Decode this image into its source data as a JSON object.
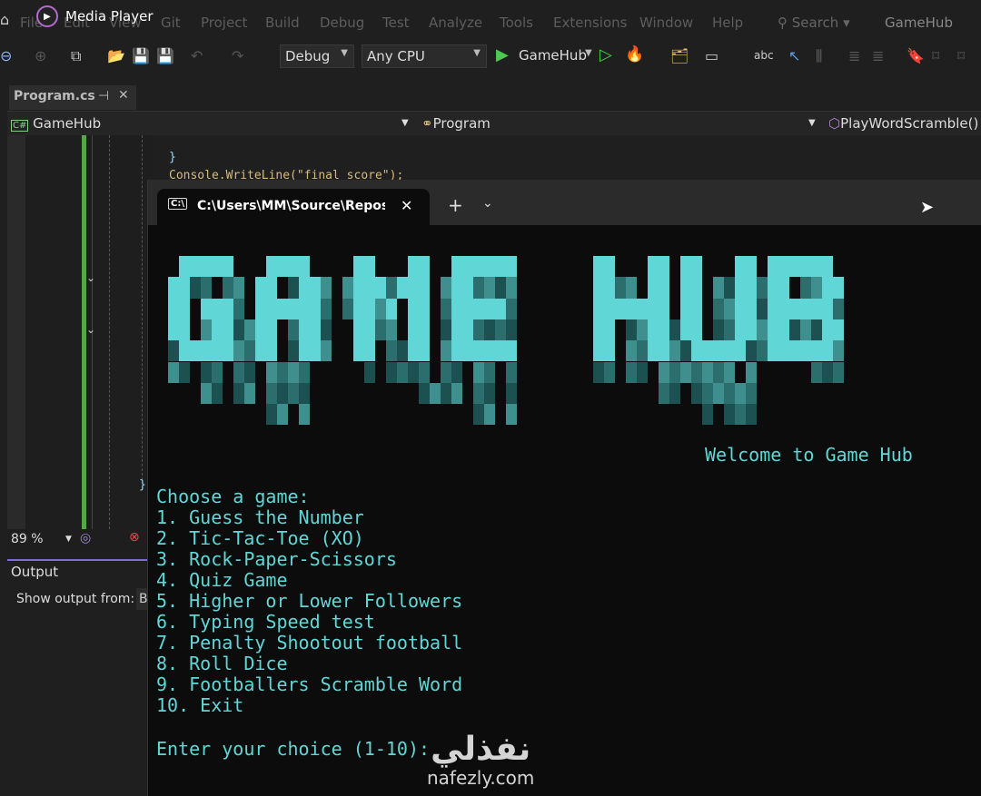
{
  "overlay": {
    "app": "Media Player"
  },
  "menu": [
    "File",
    "Edit",
    "View",
    "Git",
    "Project",
    "Build",
    "Debug",
    "Test",
    "Analyze",
    "Tools",
    "Extensions",
    "Window",
    "Help"
  ],
  "search": "Search",
  "solution_name": "GameHub",
  "toolbar": {
    "config": "Debug",
    "platform": "Any CPU",
    "start_target": "GameHub"
  },
  "editor_tab": {
    "label": "Program.cs"
  },
  "navbar": {
    "project": "GameHub",
    "class": "Program",
    "member": "PlayWordScramble()"
  },
  "code": {
    "line1": "}",
    "line2": "Console.WriteLine(\"final score\");",
    "line3": "}"
  },
  "zoom": "89 %",
  "output": {
    "title": "Output",
    "show_from": "Show output from:",
    "source": "B"
  },
  "terminal": {
    "tab_title": "C:\\Users\\MM\\Source\\Repos\\G",
    "ascii_logo_text": "GAME HUB",
    "welcome": "Welcome to Game Hub",
    "prompt_title": "Choose a game:",
    "options": [
      "1. Guess the Number",
      "2. Tic-Tac-Toe (XO)",
      "3. Rock-Paper-Scissors",
      "4. Quiz Game",
      "5. Higher or Lower Followers",
      "6. Typing Speed test",
      "7. Penalty Shootout football",
      "8. Roll Dice",
      "9. Footballers Scramble Word",
      "10. Exit"
    ],
    "input_prompt": "Enter your choice (1-10):"
  },
  "watermark": {
    "arabic": "نفذلي",
    "latin": "nafezly.com"
  },
  "colors": {
    "terminal_text": "#61d6d6",
    "run_green": "#4ec94e",
    "accent": "#7c6ad6"
  }
}
